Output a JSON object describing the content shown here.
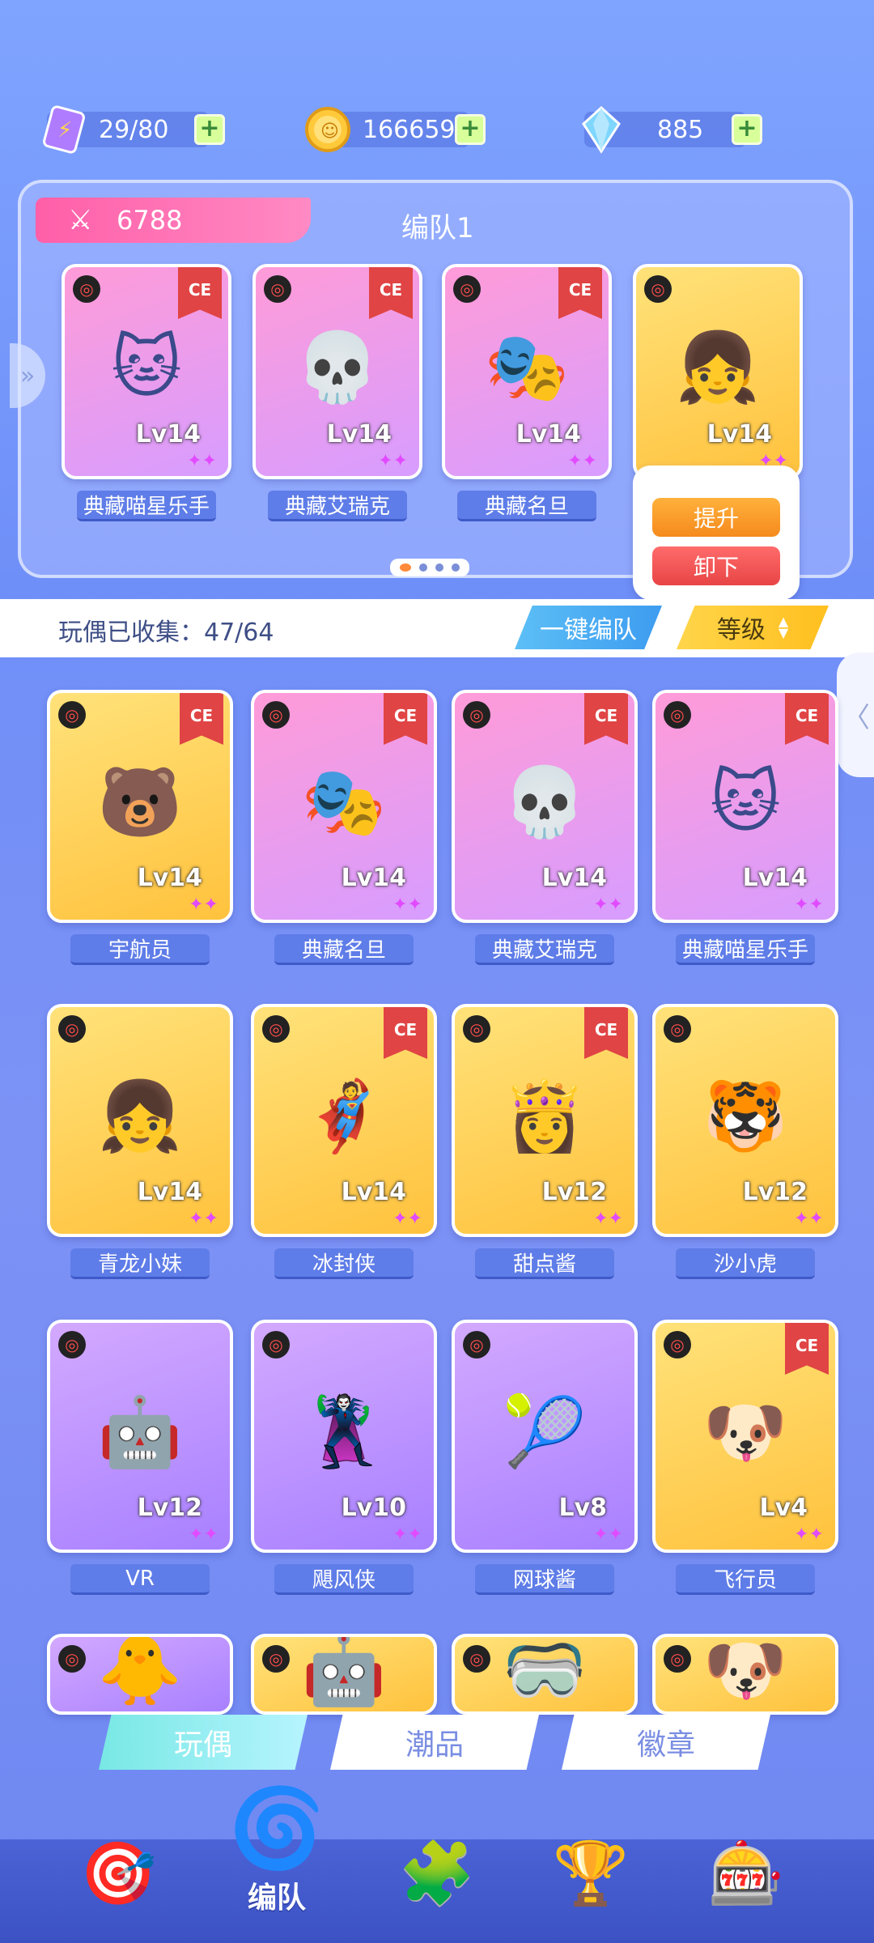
{
  "resources": [
    {
      "name": "stamina",
      "value": "29/80",
      "icon": "ticket-icon"
    },
    {
      "name": "coins",
      "value": "166659",
      "icon": "coin-icon"
    },
    {
      "name": "gems",
      "value": "885",
      "icon": "crystal-icon"
    }
  ],
  "team": {
    "power": "6788",
    "title": "编队1",
    "cards": [
      {
        "name": "典藏喵星乐手",
        "level": "Lv14",
        "emoji": "🐱",
        "bg": "pink",
        "ce": true
      },
      {
        "name": "典藏艾瑞克",
        "level": "Lv14",
        "emoji": "💀",
        "bg": "pink",
        "ce": true
      },
      {
        "name": "典藏名旦",
        "level": "Lv14",
        "emoji": "🎭",
        "bg": "pink",
        "ce": true
      },
      {
        "name": "",
        "level": "Lv14",
        "emoji": "👧",
        "bg": "yellow",
        "ce": false
      }
    ],
    "popup": {
      "upgrade": "提升",
      "unload": "卸下"
    }
  },
  "collection": {
    "label": "玩偶已收集：47/64",
    "onekey": "一键编队",
    "sort": "等级"
  },
  "grid": [
    {
      "name": "宇航员",
      "level": "Lv14",
      "emoji": "🐻",
      "bg": "yellow",
      "ce": true
    },
    {
      "name": "典藏名旦",
      "level": "Lv14",
      "emoji": "🎭",
      "bg": "pink",
      "ce": true
    },
    {
      "name": "典藏艾瑞克",
      "level": "Lv14",
      "emoji": "💀",
      "bg": "pink",
      "ce": true
    },
    {
      "name": "典藏喵星乐手",
      "level": "Lv14",
      "emoji": "🐱",
      "bg": "pink",
      "ce": true
    },
    {
      "name": "青龙小妹",
      "level": "Lv14",
      "emoji": "👧",
      "bg": "yellow",
      "ce": false
    },
    {
      "name": "冰封侠",
      "level": "Lv14",
      "emoji": "🦸",
      "bg": "yellow",
      "ce": true
    },
    {
      "name": "甜点酱",
      "level": "Lv12",
      "emoji": "👸",
      "bg": "yellow",
      "ce": true
    },
    {
      "name": "沙小虎",
      "level": "Lv12",
      "emoji": "🐯",
      "bg": "yellow",
      "ce": false
    },
    {
      "name": "VR",
      "level": "Lv12",
      "emoji": "🤖",
      "bg": "purple",
      "ce": false
    },
    {
      "name": "飓风侠",
      "level": "Lv10",
      "emoji": "🦹",
      "bg": "purple",
      "ce": false
    },
    {
      "name": "网球酱",
      "level": "Lv8",
      "emoji": "🎾",
      "bg": "purple",
      "ce": false
    },
    {
      "name": "飞行员",
      "level": "Lv4",
      "emoji": "🐶",
      "bg": "yellow",
      "ce": true
    },
    {
      "name": "",
      "level": "",
      "emoji": "🐥",
      "bg": "purple",
      "ce": false
    },
    {
      "name": "",
      "level": "",
      "emoji": "🤖",
      "bg": "yellow",
      "ce": false
    },
    {
      "name": "",
      "level": "",
      "emoji": "🥽",
      "bg": "yellow",
      "ce": false
    },
    {
      "name": "",
      "level": "",
      "emoji": "🐶",
      "bg": "yellow",
      "ce": false
    }
  ],
  "tabs": [
    "玩偶",
    "潮品",
    "徽章"
  ],
  "nav": {
    "center_label": "编队",
    "items": [
      "dart-icon",
      "team-icon",
      "puzzle-icon",
      "trophy-icon",
      "mystery-icon"
    ]
  }
}
